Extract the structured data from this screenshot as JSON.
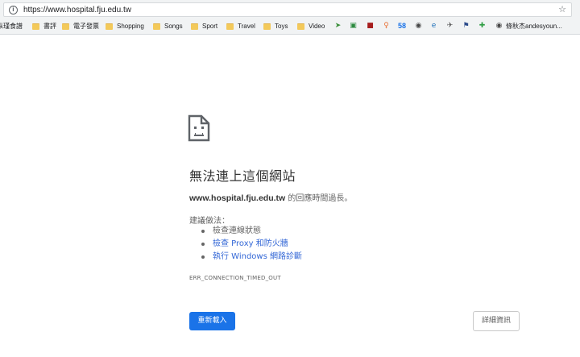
{
  "address_bar": {
    "url": "https://www.hospital.fju.edu.tw",
    "info_icon": "i",
    "star_icon": "☆"
  },
  "bookmarks": {
    "items": [
      {
        "label": "纵瑾食譜"
      },
      {
        "label": "書評"
      },
      {
        "label": "電子發票"
      },
      {
        "label": "Shopping"
      },
      {
        "label": "Songs"
      },
      {
        "label": "Sport"
      },
      {
        "label": "Travel"
      },
      {
        "label": "Toys"
      },
      {
        "label": "Video"
      }
    ],
    "icons": [
      {
        "name": "send-icon",
        "glyph": "➤",
        "color": "#3a8f3a"
      },
      {
        "name": "green-image-icon",
        "glyph": "▣",
        "color": "#2b8a3e"
      },
      {
        "name": "red-square-icon",
        "glyph": "■",
        "color": "#a61d1d"
      },
      {
        "name": "bulb-icon",
        "glyph": "♀",
        "color": "#e8743b"
      },
      {
        "name": "badge-58-icon",
        "glyph": "58",
        "color": "#1a73e8"
      },
      {
        "name": "globe-icon",
        "glyph": "◉",
        "color": "#444444"
      },
      {
        "name": "edge-icon",
        "glyph": "e",
        "color": "#1e6fb8"
      },
      {
        "name": "bird-icon",
        "glyph": "✈",
        "color": "#555555"
      },
      {
        "name": "runner-icon",
        "glyph": "⚑",
        "color": "#2a4a8a"
      },
      {
        "name": "green-cross-icon",
        "glyph": "✚",
        "color": "#2f9e44"
      },
      {
        "name": "site-globe-icon",
        "glyph": "◉",
        "color": "#444444"
      }
    ],
    "last_label": "條秋杰andesyoun..."
  },
  "error_page": {
    "title": "無法連上這個網站",
    "host": "www.hospital.fju.edu.tw",
    "desc_suffix": " 的回應時間過長。",
    "suggestions_label": "建議做法：",
    "suggestions": [
      {
        "text": "檢查連線狀態"
      },
      {
        "text": "檢查 Proxy 和防火牆"
      },
      {
        "text": "執行 Windows 網路診斷"
      }
    ],
    "error_code": "ERR_CONNECTION_TIMED_OUT",
    "reload_label": "重新載入",
    "details_label": "詳細資訊"
  }
}
